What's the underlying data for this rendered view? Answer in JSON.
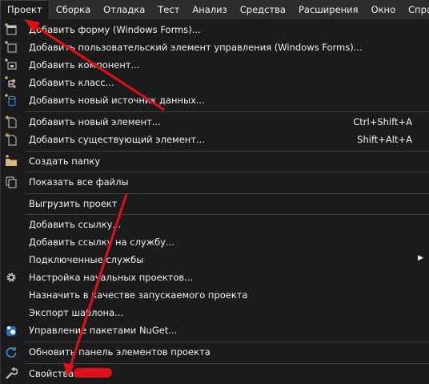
{
  "menubar": {
    "items": [
      "Проект",
      "Сборка",
      "Отладка",
      "Тест",
      "Анализ",
      "Средства",
      "Расширения",
      "Окно",
      "Спра"
    ]
  },
  "menu": {
    "items": [
      {
        "label": "Добавить форму (Windows Forms)...",
        "icon": "add-form-icon"
      },
      {
        "label": "Добавить пользовательский элемент управления (Windows Forms)...",
        "icon": "add-user-control-icon"
      },
      {
        "label": "Добавить компонент...",
        "icon": "add-component-icon"
      },
      {
        "label": "Добавить класс...",
        "icon": "add-class-icon"
      },
      {
        "label": "Добавить новый источник данных...",
        "icon": "add-data-source-icon"
      },
      {
        "label": "Добавить новый элемент...",
        "shortcut": "Ctrl+Shift+A",
        "icon": "add-new-item-icon"
      },
      {
        "label": "Добавить существующий элемент...",
        "shortcut": "Shift+Alt+A",
        "icon": "add-existing-item-icon"
      },
      {
        "label": "Создать папку",
        "icon": "new-folder-icon"
      },
      {
        "label": "Показать все файлы",
        "icon": "show-all-files-icon"
      },
      {
        "label": "Выгрузить проект"
      },
      {
        "label": "Добавить ссылку..."
      },
      {
        "label": "Добавить ссылку на службу..."
      },
      {
        "label": "Подключенные службы"
      },
      {
        "label": "Настройка начальных проектов...",
        "icon": "gear-icon"
      },
      {
        "label": "Назначить в качестве запускаемого проекта"
      },
      {
        "label": "Экспорт шаблона..."
      },
      {
        "label": "Управление пакетами NuGet...",
        "icon": "nuget-icon"
      },
      {
        "label": "Обновить панель элементов проекта",
        "icon": "refresh-icon"
      },
      {
        "label": "Свойства:",
        "icon": "wrench-icon"
      }
    ]
  },
  "colors": {
    "accent": "#007acc",
    "arrow": "#e0101a",
    "icon_yellow": "#dcb67a"
  }
}
